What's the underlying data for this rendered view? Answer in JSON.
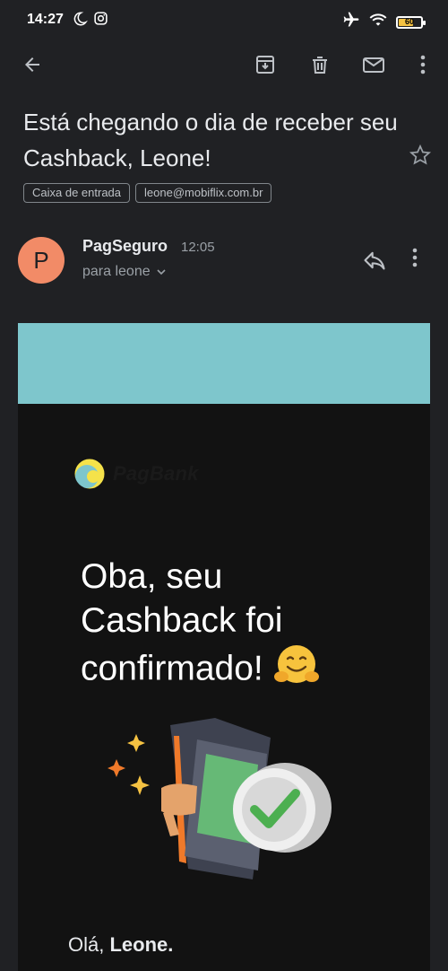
{
  "status_bar": {
    "time": "14:27",
    "battery": "60",
    "icons": [
      "moon-icon",
      "instagram-icon",
      "airplane-icon",
      "wifi-icon",
      "battery-icon"
    ]
  },
  "toolbar": {
    "icons": [
      "back-arrow-icon",
      "archive-icon",
      "delete-icon",
      "mark-unread-icon",
      "more-vert-icon"
    ]
  },
  "email": {
    "subject": "Está chegando o dia de receber seu Cashback, Leone!",
    "labels": [
      "Caixa de entrada",
      "leone@mobiflix.com.br"
    ],
    "sender": {
      "initial": "P",
      "name": "PagSeguro",
      "time": "12:05",
      "recipient": "para leone"
    },
    "body": {
      "brand": "PagBank",
      "headline": "Oba, seu Cashback foi confirmado!",
      "greeting_prefix": "Olá, ",
      "greeting_name": "Leone."
    }
  },
  "colors": {
    "background": "#202124",
    "avatar": "#f28b67",
    "banner": "#7ec6cc",
    "card": "#121212",
    "battery": "#f5c242"
  }
}
